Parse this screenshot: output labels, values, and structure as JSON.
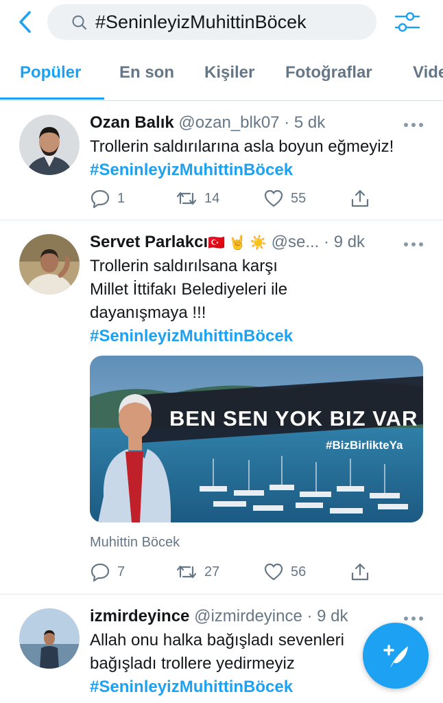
{
  "search": {
    "query": "#SeninleyizMuhittinBöcek"
  },
  "tabs": [
    {
      "label": "Popüler"
    },
    {
      "label": "En son"
    },
    {
      "label": "Kişiler"
    },
    {
      "label": "Fotoğraflar"
    },
    {
      "label": "Vide"
    }
  ],
  "tweets": [
    {
      "name": "Ozan Balık",
      "handle": "@ozan_blk07",
      "sep": "·",
      "time": "5 dk",
      "text_lines": [
        "Trollerin saldırılarına asla boyun eğmeyiz!"
      ],
      "hashtag": "#SeninleyizMuhittinBöcek",
      "replies": "1",
      "retweets": "14",
      "likes": "55"
    },
    {
      "name": "Servet Parlakcı",
      "emoji": "🇹🇷 🤘 ☀️",
      "handle": "@se...",
      "sep": "·",
      "time": "9 dk",
      "text_lines": [
        "Trollerin saldırılsana karşı",
        "Millet İttifakı Belediyeleri ile",
        "dayanışmaya !!!"
      ],
      "hashtag": "#SeninleyizMuhittinBöcek",
      "media": {
        "headline": "BEN SEN YOK BIZ VAR",
        "tag": "#BizBirlikteYa"
      },
      "media_caption": "Muhittin Böcek",
      "replies": "7",
      "retweets": "27",
      "likes": "56"
    },
    {
      "name": "izmirdeyince",
      "handle": "@izmirdeyince",
      "sep": "·",
      "time": "9 dk",
      "text_lines": [
        "Allah onu halka bağışladı sevenleri",
        "bağışladı trollere yedirmeyiz"
      ],
      "hashtag": "#SeninleyizMuhittinBöcek"
    }
  ],
  "colors": {
    "accent": "#1da1f2",
    "muted": "#657786",
    "text": "#14171a"
  }
}
